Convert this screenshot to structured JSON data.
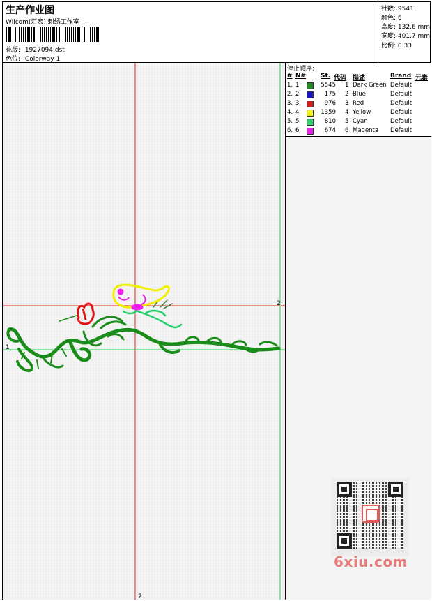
{
  "header": {
    "title": "生产作业图",
    "subtitle": "Wilcom(汇宏) 刺绣工作室",
    "design_label": "花版:",
    "design_value": "1927094.dst",
    "colorway_label": "色位:",
    "colorway_value": "Colorway 1"
  },
  "stats": {
    "stitches": "针数: 9541",
    "colors": "颜色: 6",
    "height": "高度: 132.6 mm",
    "width": "宽度: 401.7 mm",
    "scale": "比例: 0.33"
  },
  "canvas": {
    "marker_top": "2",
    "marker_left": "1",
    "marker_bottom": "2"
  },
  "stop_sequence": {
    "title": "停止顺序:",
    "headers": {
      "hash": "#",
      "no": "N#",
      "st": "St.",
      "code": "代码",
      "desc": "描述",
      "brand": "Brand",
      "element": "元素"
    },
    "rows": [
      {
        "hash": "1.",
        "no": "1",
        "color": "#1a8c1a",
        "st": "5545",
        "code": "1",
        "desc": "Dark Green",
        "brand": "Default"
      },
      {
        "hash": "2.",
        "no": "2",
        "color": "#1414d2",
        "st": "175",
        "code": "2",
        "desc": "Blue",
        "brand": "Default"
      },
      {
        "hash": "3.",
        "no": "3",
        "color": "#e01414",
        "st": "976",
        "code": "3",
        "desc": "Red",
        "brand": "Default"
      },
      {
        "hash": "4.",
        "no": "4",
        "color": "#f0f000",
        "st": "1359",
        "code": "4",
        "desc": "Yellow",
        "brand": "Default"
      },
      {
        "hash": "5.",
        "no": "5",
        "color": "#22d06a",
        "st": "810",
        "code": "5",
        "desc": "Cyan",
        "brand": "Default"
      },
      {
        "hash": "6.",
        "no": "6",
        "color": "#f01cf0",
        "st": "674",
        "code": "6",
        "desc": "Magenta",
        "brand": "Default"
      }
    ]
  },
  "watermark": "6xiu.com",
  "guide_colors": {
    "red": "#e02020",
    "green": "#20d050"
  }
}
